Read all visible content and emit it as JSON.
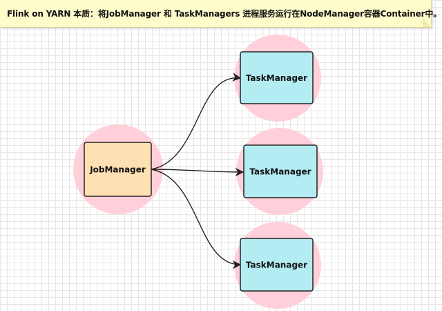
{
  "note": {
    "text": "Flink on YARN 本质：将JobManager 和 TaskManagers 进程服务运行在NodeManager容器Container中。"
  },
  "nodes": {
    "jobmanager": {
      "label": "JobManager"
    },
    "taskmanager_1": {
      "label": "TaskManager"
    },
    "taskmanager_2": {
      "label": "TaskManager"
    },
    "taskmanager_3": {
      "label": "TaskManager"
    }
  },
  "colors": {
    "note_bg": "#fffccc",
    "container_circle": "#ffd0d9",
    "jobmanager_fill": "#ffe0b3",
    "taskmanager_fill": "#b3ecf2",
    "stroke": "#222222"
  }
}
